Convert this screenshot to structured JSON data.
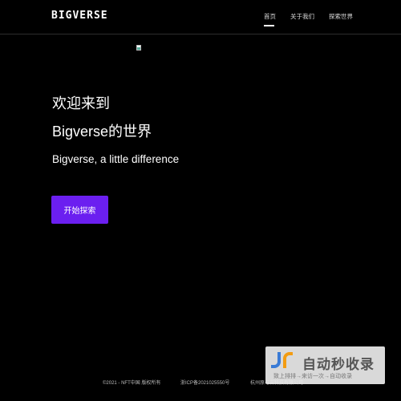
{
  "header": {
    "logo": "BIGVERSE",
    "nav": [
      {
        "label": "首页"
      },
      {
        "label": "关于我们"
      },
      {
        "label": "探索世界"
      }
    ]
  },
  "hero": {
    "line1": "欢迎来到",
    "line2": "Bigverse的世界",
    "subtitle": "Bigverse, a little difference",
    "cta_label": "开始探索"
  },
  "footer": {
    "copyright": "©2021 - NFT中国 版权所有",
    "icp": "浙ICP备2021025550号",
    "company": "杭州原与宙科技有限公司"
  },
  "watermark": {
    "title": "自动秒收录",
    "subtitle": "致上排排→来访一次→自动收录"
  },
  "colors": {
    "background": "#000000",
    "accent": "#6b1ff0",
    "text": "#ffffff"
  }
}
